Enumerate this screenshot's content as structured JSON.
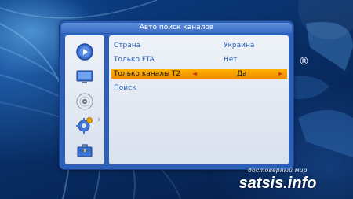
{
  "dialog": {
    "title": "Авто поиск каналов"
  },
  "sidebar": {
    "icons": [
      {
        "name": "play-icon"
      },
      {
        "name": "tv-screen-icon"
      },
      {
        "name": "disc-icon",
        "active": true
      },
      {
        "name": "settings-gear-icon"
      },
      {
        "name": "toolbox-icon"
      }
    ],
    "chevron": "›"
  },
  "menu": {
    "rows": [
      {
        "label": "Страна",
        "value": "Украина"
      },
      {
        "label": "Только FTA",
        "value": "Нет"
      },
      {
        "label": "Только каналы T2",
        "value": "Да",
        "selected": true
      },
      {
        "label": "Поиск",
        "value": ""
      }
    ],
    "arrow_left": "◄",
    "arrow_right": "►"
  },
  "brand": {
    "registered": "®",
    "watermark_tagline": "достоверный мир",
    "watermark_name": "satsis.info"
  },
  "colors": {
    "accent_blue": "#2c5fb8",
    "selection_orange": "#ffb300",
    "text_blue": "#2a62b8"
  }
}
